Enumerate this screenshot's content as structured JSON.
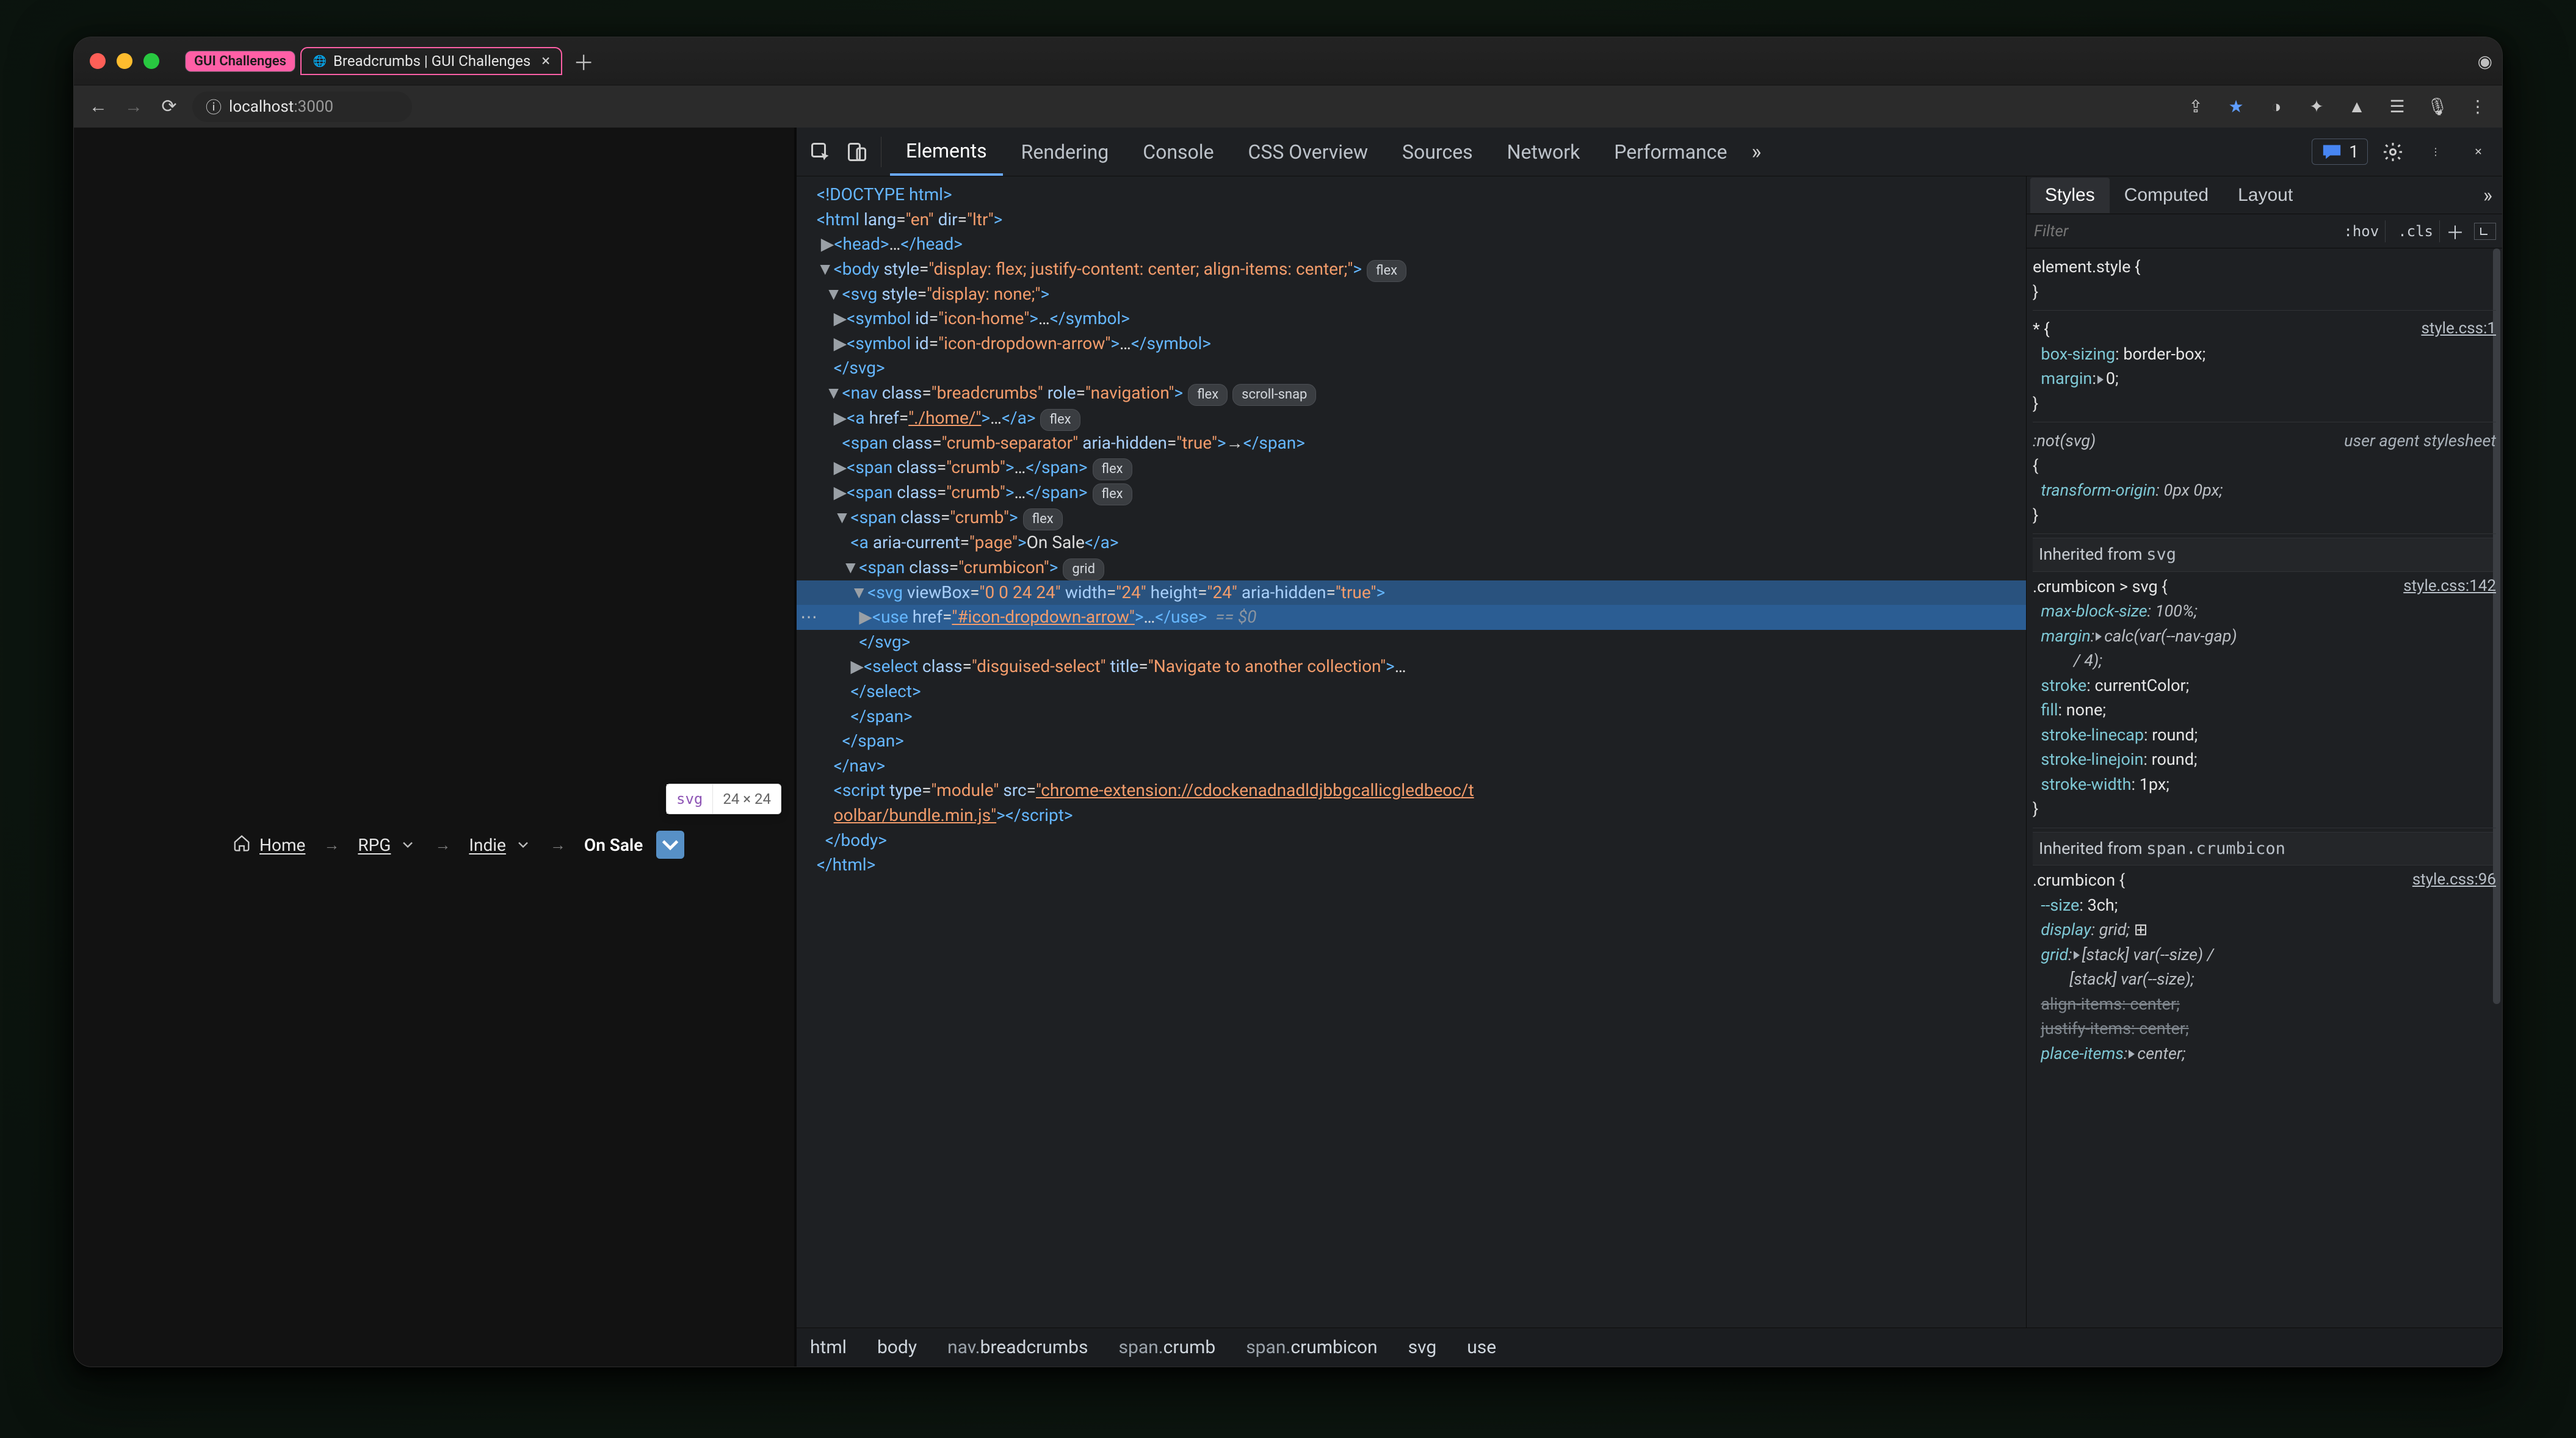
{
  "window": {
    "tabs": {
      "pill_label": "GUI Challenges",
      "active_label": "Breadcrumbs | GUI Challenges"
    },
    "address": {
      "host": "localhost",
      "port": ":3000"
    }
  },
  "page": {
    "tooltip": {
      "name": "svg",
      "dims": "24 × 24"
    },
    "home": "Home",
    "rpg": "RPG",
    "indie": "Indie",
    "on_sale": "On Sale"
  },
  "devtools": {
    "tabs": {
      "elements": "Elements",
      "rendering": "Rendering",
      "console": "Console",
      "css_overview": "CSS Overview",
      "sources": "Sources",
      "network": "Network",
      "performance": "Performance"
    },
    "issue_count": "1",
    "styles_tabs": {
      "styles": "Styles",
      "computed": "Computed",
      "layout": "Layout"
    },
    "filter_placeholder": "Filter",
    "hov": ":hov",
    "cls": ".cls",
    "dom": {
      "doctype": "<!DOCTYPE html>",
      "html_open": "<html lang=\"en\" dir=\"ltr\">",
      "head": "  ▶<head>…</head>",
      "body_open": "  ▼<body style=\"display: flex; justify-content: center; align-items: center;\">",
      "body_pill": "flex",
      "svg_open": "    ▼<svg style=\"display: none;\">",
      "sym_home": "      ▶<symbol id=\"icon-home\">…</symbol>",
      "sym_arrow": "      ▶<symbol id=\"icon-dropdown-arrow\">…</symbol>",
      "svg_close": "      </svg>",
      "nav_open": "    ▼<nav class=\"breadcrumbs\" role=\"navigation\">",
      "nav_pills": [
        "flex",
        "scroll-snap"
      ],
      "a_home": "      ▶<a href=\"./home/\">…</a>",
      "a_home_pill": "flex",
      "sep": "        <span class=\"crumb-separator\" aria-hidden=\"true\">→</span>",
      "crumb1": "      ▶<span class=\"crumb\">…</span>",
      "crumb2": "      ▶<span class=\"crumb\">…</span>",
      "crumb_pill": "flex",
      "crumb3_open": "      ▼<span class=\"crumb\">",
      "a_page": "          <a aria-current=\"page\">On Sale</a>",
      "icon_open": "        ▼<span class=\"crumbicon\">",
      "icon_pill": "grid",
      "svg_sel": "          ▼<svg viewBox=\"0 0 24 24\" width=\"24\" height=\"24\" aria-hidden=\"true\">",
      "use_sel": "            ▶<use href=\"#icon-dropdown-arrow\">…</use>  == $0",
      "svg_end": "            </svg>",
      "select": "          ▶<select class=\"disguised-select\" title=\"Navigate to another collection\">…",
      "select_end": "          </select>",
      "span_end1": "          </span>",
      "span_end2": "        </span>",
      "nav_end": "      </nav>",
      "script": "      <script type=\"module\" src=\"chrome-extension://cdockenadnadldjbbgcallicgledbeoc/t",
      "script2": "      oolbar/bundle.min.js\"></script>",
      "body_end": "    </body>",
      "html_end": "  </html>"
    },
    "pathbar": [
      "html",
      "body",
      "nav.breadcrumbs",
      "span.crumb",
      "span.crumbicon",
      "svg",
      "use"
    ],
    "styles": {
      "element_style": "element.style {",
      "star_src": "style.css:1",
      "star_sel": "* {",
      "star_p1": "box-sizing: border-box;",
      "star_p2": "margin: ▸ 0;",
      "not_svg": ":not(svg)",
      "ua": "user agent stylesheet",
      "not_p1": "transform-origin: 0px 0px;",
      "inh_svg": "Inherited from ",
      "inh_svg_kw": "svg",
      "c_svg_sel": ".crumbicon > svg {",
      "c_svg_src": "style.css:142",
      "c_svg_p1": "max-block-size: 100%;",
      "c_svg_p2": "margin: ▸ calc(var(--nav-gap)",
      "c_svg_p2b": "            / 4);",
      "c_svg_p3": "stroke: currentColor;",
      "c_svg_p4": "fill: none;",
      "c_svg_p5": "stroke-linecap: round;",
      "c_svg_p6": "stroke-linejoin: round;",
      "c_svg_p7": "stroke-width: 1px;",
      "inh_span": "Inherited from ",
      "inh_span_kw": "span.crumbicon",
      "ci_sel": ".crumbicon {",
      "ci_src": "style.css:96",
      "ci_p1": "--size: 3ch;",
      "ci_p2": "display: grid; ▦",
      "ci_p3": "grid: ▸ [stack] var(--size) /",
      "ci_p3b": "         [stack] var(--size);",
      "ci_p4": "align-items: center;",
      "ci_p5": "justify-items: center;",
      "ci_p6": "place-items: ▸ center;"
    }
  }
}
